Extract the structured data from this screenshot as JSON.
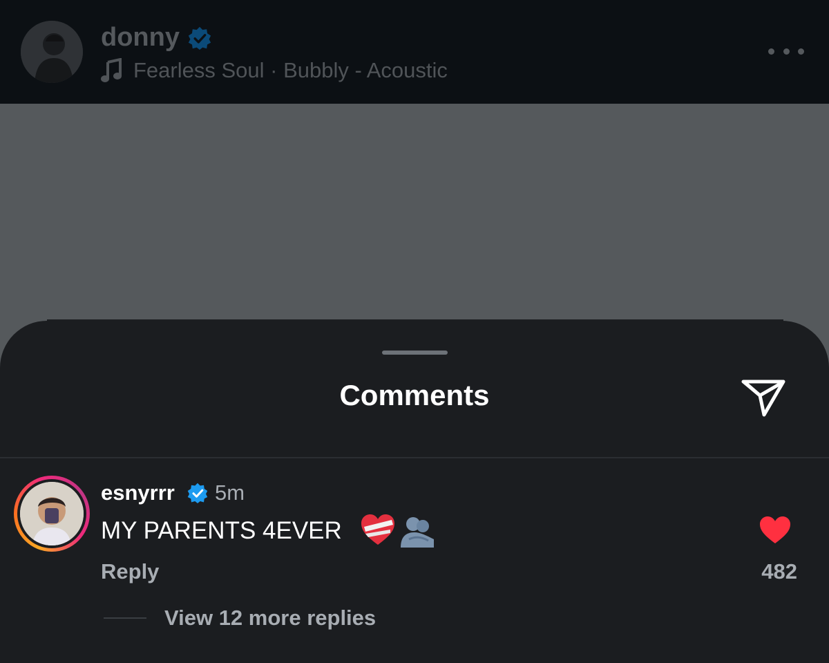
{
  "post": {
    "username": "donny",
    "audio": "Fearless Soul · Bubbly - Acoustic",
    "icons": {
      "verified": "verified-badge-icon",
      "music": "music-note-icon",
      "more": "more-horizontal-icon"
    }
  },
  "comments_sheet": {
    "title": "Comments",
    "share_icon": "send-icon",
    "comments": [
      {
        "username": "esnyrrr",
        "verified": true,
        "time": "5m",
        "text": "MY PARENTS 4EVER",
        "emojis": [
          "mending-heart-emoji",
          "people-hugging-emoji"
        ],
        "reply_label": "Reply",
        "likes": "482",
        "liked": true,
        "view_replies_label": "View 12 more replies"
      }
    ]
  },
  "colors": {
    "verified_blue": "#1d9bf0",
    "like_red": "#ff3040",
    "sheet_bg": "#1b1d20",
    "header_bg": "#0c1014"
  }
}
